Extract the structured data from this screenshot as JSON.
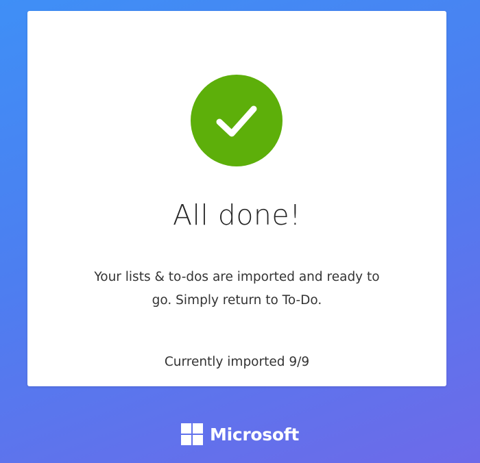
{
  "dialog": {
    "title": "All done!",
    "message_line1": "Your lists & to-dos are imported and ready to",
    "message_line2": "go. Simply return to To-Do.",
    "progress": "Currently imported 9/9",
    "status_icon": "checkmark-icon",
    "status_color": "#5daf0a"
  },
  "footer": {
    "brand": "Microsoft",
    "logo_icon": "windows-logo-icon"
  },
  "colors": {
    "background_start": "#3f8ff6",
    "background_end": "#6d6ae9",
    "card": "#ffffff"
  }
}
